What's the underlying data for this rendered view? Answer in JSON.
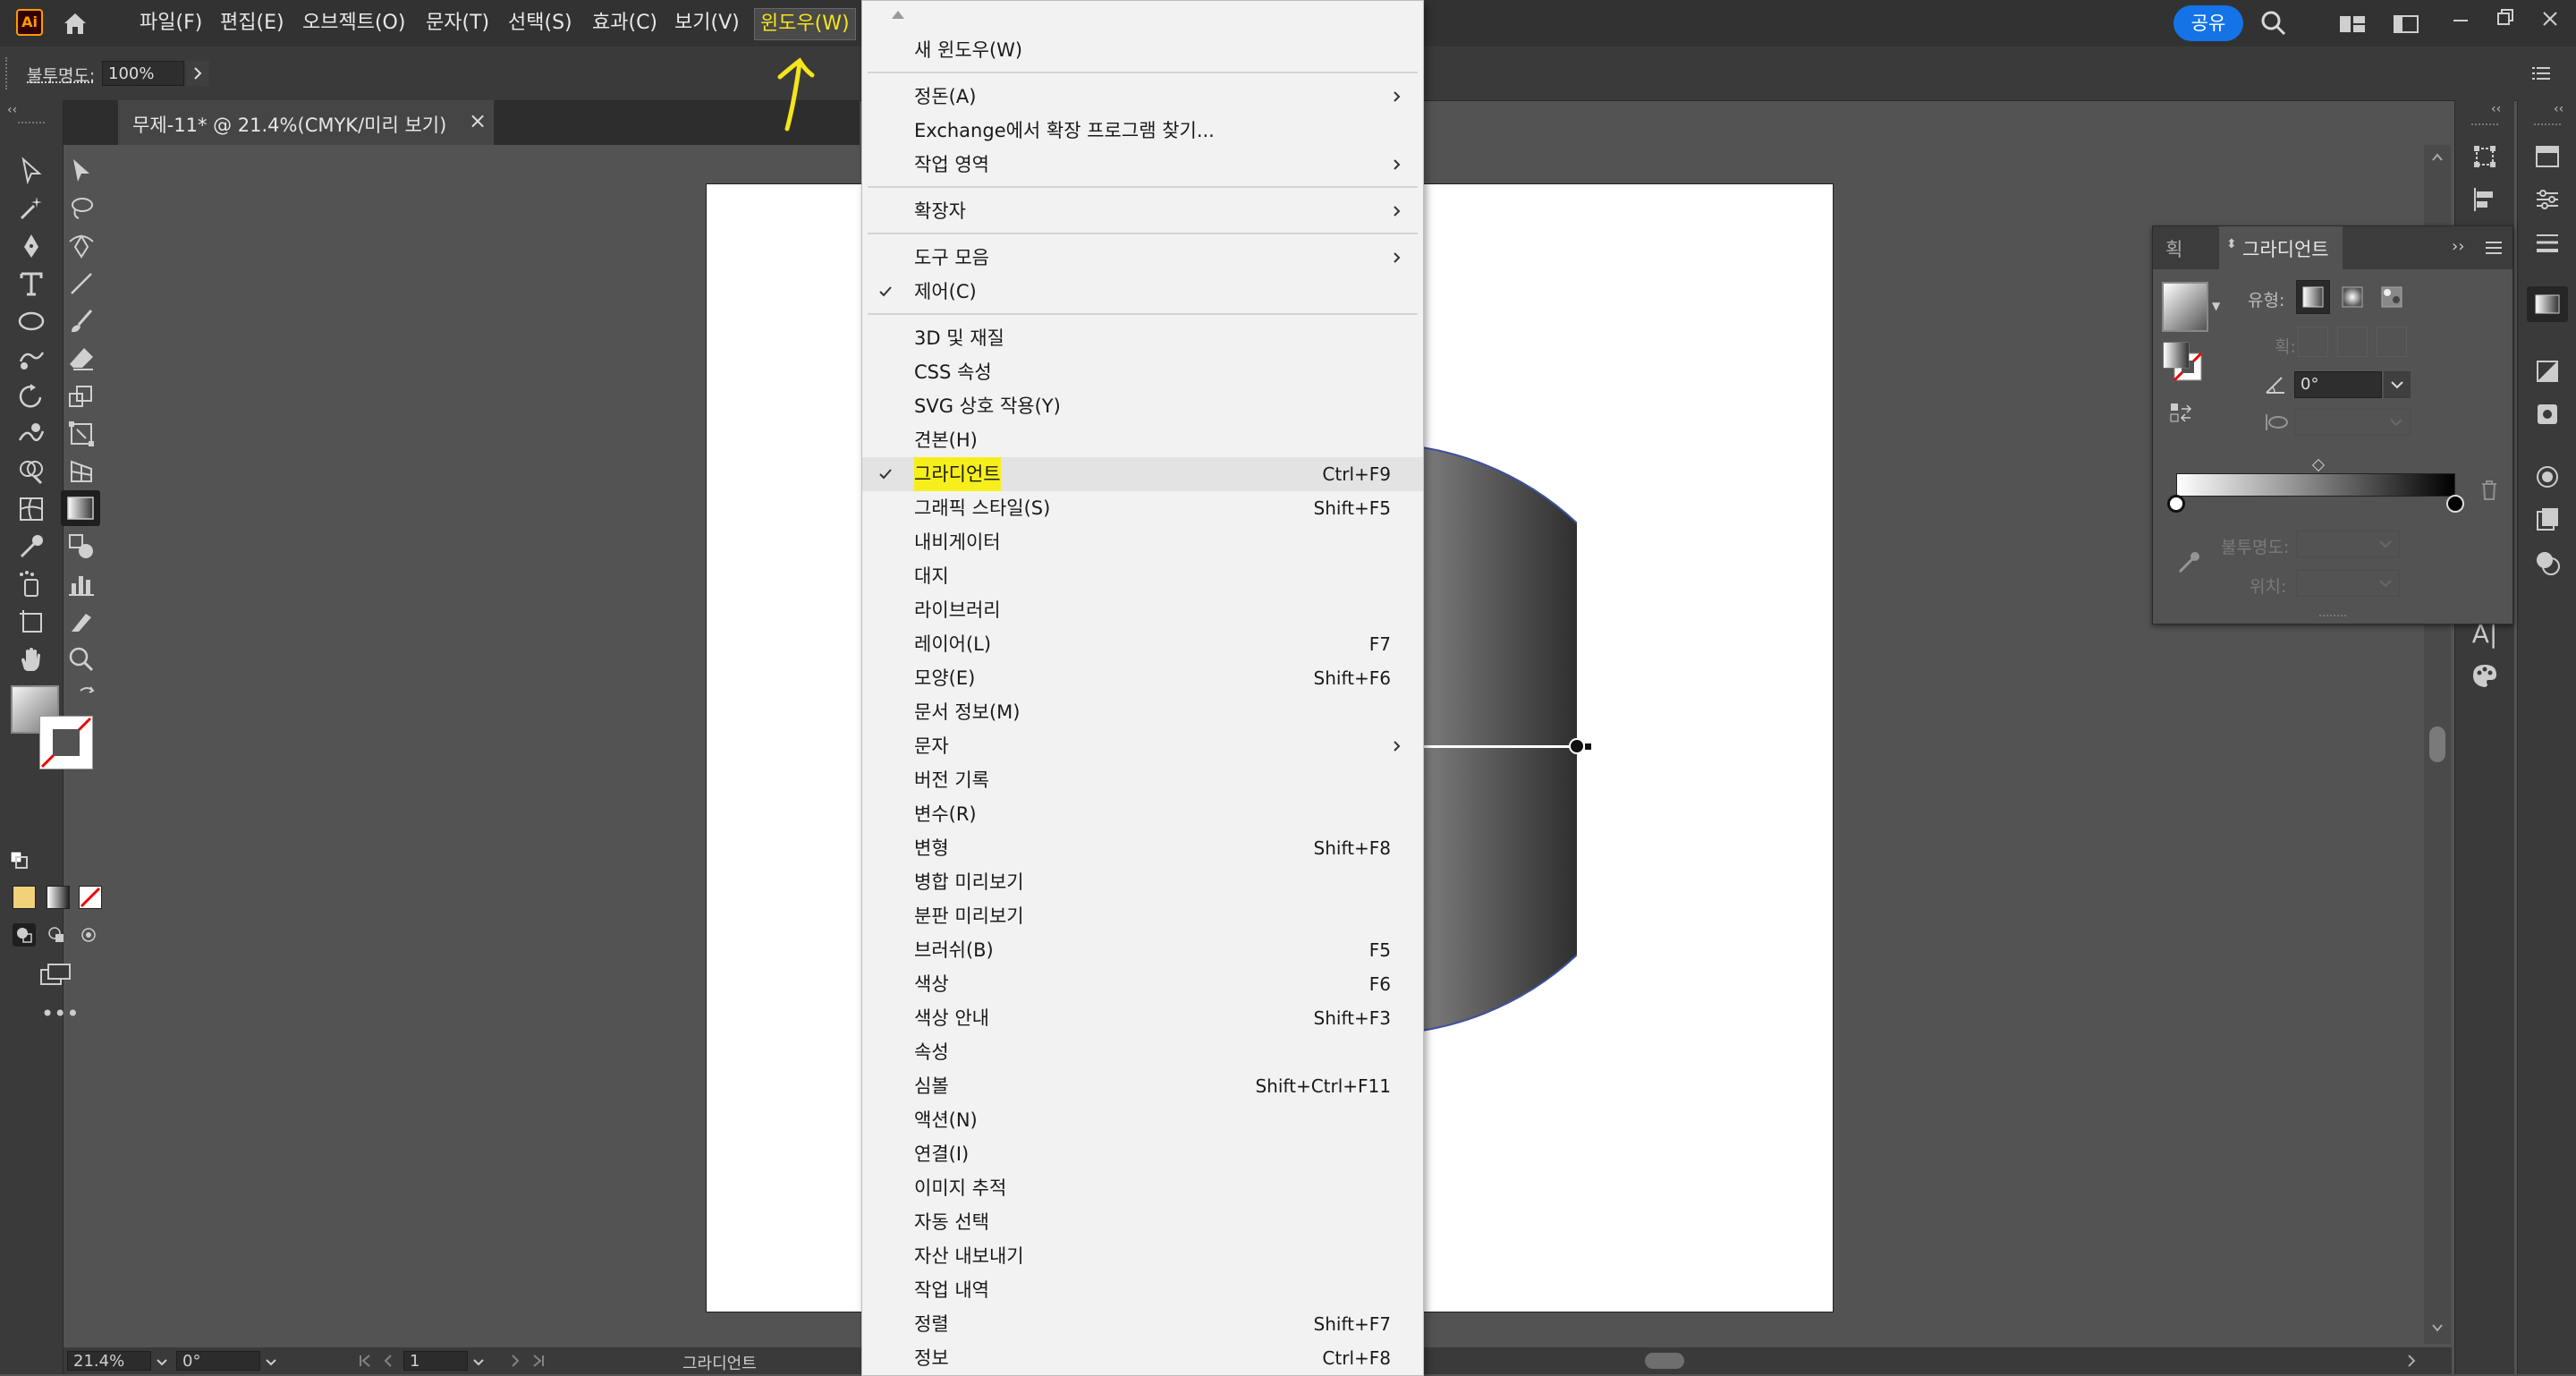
{
  "app": {
    "logo_text": "Ai"
  },
  "menubar": {
    "items": [
      "파일(F)",
      "편집(E)",
      "오브젝트(O)",
      "문자(T)",
      "선택(S)",
      "효과(C)",
      "보기(V)",
      "윈도우(W)"
    ],
    "active_index": 7,
    "share_label": "공유"
  },
  "controlbar": {
    "opacity_label": "불투명도:",
    "opacity_value": "100%"
  },
  "document": {
    "tab_title": "무제-11* @ 21.4%(CMYK/미리 보기)",
    "close_glyph": "×"
  },
  "statusbar": {
    "zoom": "21.4%",
    "rotation": "0°",
    "artboard": "1",
    "tool_name": "그라디언트"
  },
  "window_menu": {
    "items": [
      {
        "label": "새 윈도우(W)"
      },
      {
        "sep": true
      },
      {
        "label": "정돈(A)",
        "submenu": true
      },
      {
        "label": "Exchange에서 확장 프로그램 찾기..."
      },
      {
        "label": "작업 영역",
        "submenu": true
      },
      {
        "sep": true
      },
      {
        "label": "확장자",
        "submenu": true
      },
      {
        "sep": true
      },
      {
        "label": "도구 모음",
        "submenu": true
      },
      {
        "label": "제어(C)",
        "checked": true
      },
      {
        "sep": true
      },
      {
        "label": "3D 및 재질"
      },
      {
        "label": "CSS 속성"
      },
      {
        "label": "SVG 상호 작용(Y)"
      },
      {
        "label": "견본(H)"
      },
      {
        "label": "그라디언트",
        "shortcut": "Ctrl+F9",
        "checked": true,
        "highlighted": true
      },
      {
        "label": "그래픽 스타일(S)",
        "shortcut": "Shift+F5"
      },
      {
        "label": "내비게이터"
      },
      {
        "label": "대지"
      },
      {
        "label": "라이브러리"
      },
      {
        "label": "레이어(L)",
        "shortcut": "F7"
      },
      {
        "label": "모양(E)",
        "shortcut": "Shift+F6"
      },
      {
        "label": "문서 정보(M)"
      },
      {
        "label": "문자",
        "submenu": true
      },
      {
        "label": "버전 기록"
      },
      {
        "label": "변수(R)"
      },
      {
        "label": "변형",
        "shortcut": "Shift+F8"
      },
      {
        "label": "병합 미리보기"
      },
      {
        "label": "분판 미리보기"
      },
      {
        "label": "브러쉬(B)",
        "shortcut": "F5"
      },
      {
        "label": "색상",
        "shortcut": "F6"
      },
      {
        "label": "색상 안내",
        "shortcut": "Shift+F3"
      },
      {
        "label": "속성"
      },
      {
        "label": "심볼",
        "shortcut": "Shift+Ctrl+F11"
      },
      {
        "label": "액션(N)"
      },
      {
        "label": "연결(I)"
      },
      {
        "label": "이미지 추적"
      },
      {
        "label": "자동 선택"
      },
      {
        "label": "자산 내보내기"
      },
      {
        "label": "작업 내역"
      },
      {
        "label": "정렬",
        "shortcut": "Shift+F7"
      },
      {
        "label": "정보",
        "shortcut": "Ctrl+F8"
      }
    ]
  },
  "gradient_panel": {
    "tab_stroke": "획",
    "tab_gradient": "그라디언트",
    "type_label": "유형:",
    "stroke_label": "획:",
    "angle_value": "0°",
    "opacity_label": "불투명도:",
    "location_label": "위치:"
  },
  "colors": {
    "accent_blue": "#1473e6",
    "menu_highlight": "#f7ef1c",
    "annotation_yellow": "#f5e51b"
  }
}
